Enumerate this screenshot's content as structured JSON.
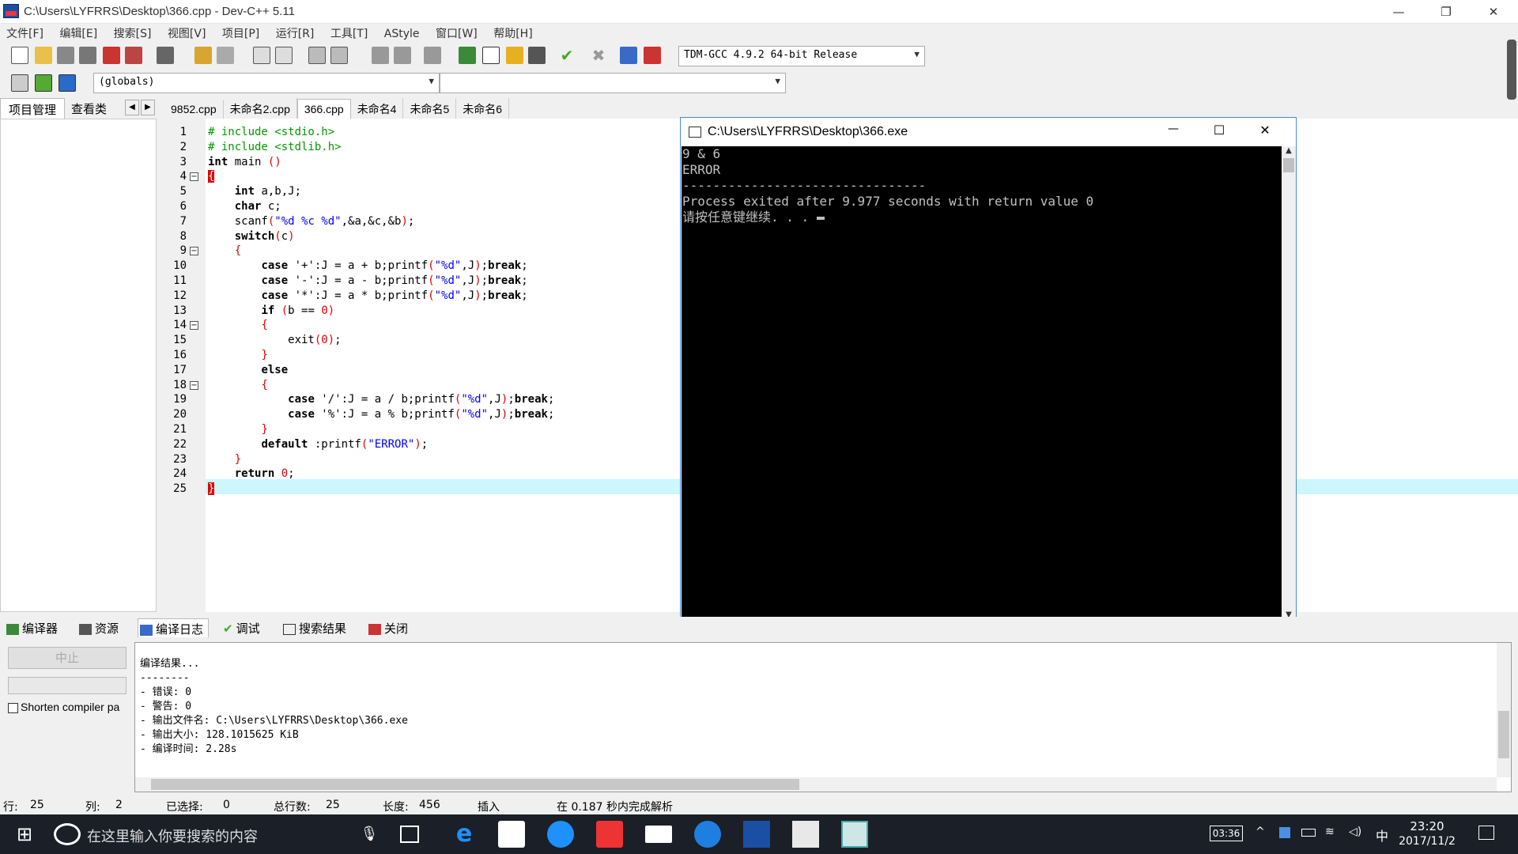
{
  "window": {
    "title": "C:\\Users\\LYFRRS\\Desktop\\366.cpp - Dev-C++ 5.11",
    "min": "—",
    "max": "❐",
    "close": "✕"
  },
  "menu": [
    "文件[F]",
    "编辑[E]",
    "搜索[S]",
    "视图[V]",
    "项目[P]",
    "运行[R]",
    "工具[T]",
    "AStyle",
    "窗口[W]",
    "帮助[H]"
  ],
  "toolbar": {
    "compiler_select": "TDM-GCC 4.9.2 64-bit Release",
    "scope_select": "(globals)",
    "symbol_select": ""
  },
  "left_tabs": {
    "project": "项目管理",
    "classes": "查看类",
    "prev": "◀",
    "next": "▶"
  },
  "file_tabs": [
    "9852.cpp",
    "未命名2.cpp",
    "366.cpp",
    "未命名4",
    "未命名5",
    "未命名6"
  ],
  "active_tab": "366.cpp",
  "code_lines": [
    "# include <stdio.h>",
    "# include <stdlib.h>",
    "int main ()",
    "{",
    "    int a,b,J;",
    "    char c;",
    "    scanf(\"%d %c %d\",&a,&c,&b);",
    "    switch(c)",
    "    {",
    "        case '+':J = a + b;printf(\"%d\",J);break;",
    "        case '-':J = a - b;printf(\"%d\",J);break;",
    "        case '*':J = a * b;printf(\"%d\",J);break;",
    "        if (b == 0)",
    "        {",
    "            exit(0);",
    "        }",
    "        else",
    "        {",
    "            case '/':J = a / b;printf(\"%d\",J);break;",
    "            case '%':J = a % b;printf(\"%d\",J);break;",
    "        }",
    "        default :printf(\"ERROR\");",
    "    }",
    "    return 0;",
    "}"
  ],
  "line_numbers": [
    "1",
    "2",
    "3",
    "4",
    "5",
    "6",
    "7",
    "8",
    "9",
    "10",
    "11",
    "12",
    "13",
    "14",
    "15",
    "16",
    "17",
    "18",
    "19",
    "20",
    "21",
    "22",
    "23",
    "24",
    "25"
  ],
  "console": {
    "title": "C:\\Users\\LYFRRS\\Desktop\\366.exe",
    "min": "—",
    "max": "☐",
    "close": "✕",
    "lines": [
      "9 & 6",
      "ERROR",
      "--------------------------------",
      "Process exited after 9.977 seconds with return value 0",
      "请按任意键继续. . ."
    ]
  },
  "bottom_tabs": [
    "编译器",
    "资源",
    "编译日志",
    "调试",
    "搜索结果",
    "关闭"
  ],
  "bottom": {
    "abort_button": "中止",
    "shorten_label": "Shorten compiler pa",
    "log_lines": [
      "编译结果...",
      "--------",
      "- 错误: 0",
      "- 警告: 0",
      "- 输出文件名: C:\\Users\\LYFRRS\\Desktop\\366.exe",
      "- 输出大小: 128.1015625 KiB",
      "- 编译时间: 2.28s"
    ]
  },
  "status": {
    "row_label": "行:",
    "row": "25",
    "col_label": "列:",
    "col": "2",
    "sel_label": "已选择:",
    "sel": "0",
    "lines_label": "总行数:",
    "lines": "25",
    "len_label": "长度:",
    "len": "456",
    "mode": "插入",
    "parse": "在 0.187 秒内完成解析"
  },
  "taskbar": {
    "search_placeholder": "在这里输入你要搜索的内容",
    "time": "23:20",
    "date": "2017/11/2",
    "ime": "中",
    "battery_badge": "03:36"
  },
  "colors": {
    "accent": "#0078d7",
    "keyword": "#000000",
    "string": "#0000ff",
    "number": "#e00000",
    "preprocessor": "#009900",
    "current_line": "#ccf7ff"
  }
}
